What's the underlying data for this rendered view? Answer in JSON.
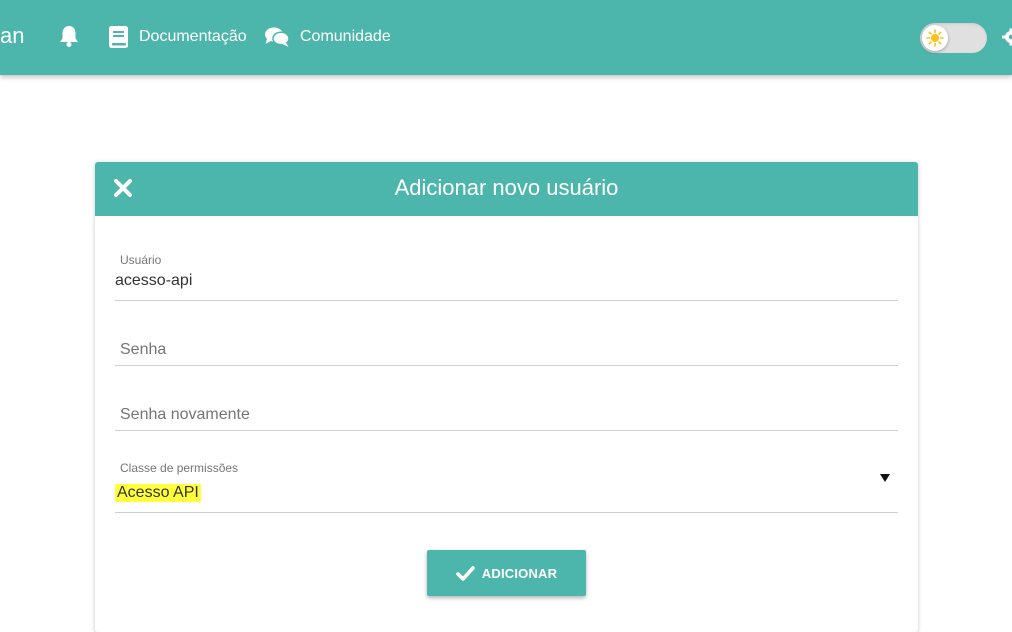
{
  "navbar": {
    "brand_fragment": "an",
    "links": [
      {
        "label": "Documentação",
        "icon": "book-icon"
      },
      {
        "label": "Comunidade",
        "icon": "chat-icon"
      }
    ],
    "theme_toggle": {
      "state": "light",
      "icon": "sun-icon"
    }
  },
  "dialog": {
    "title": "Adicionar novo usuário",
    "fields": {
      "username": {
        "label": "Usuário",
        "value": "acesso-api"
      },
      "password": {
        "placeholder": "Senha"
      },
      "password_confirm": {
        "placeholder": "Senha novamente"
      },
      "permission_class": {
        "label": "Classe de permissões",
        "value": "Acesso API"
      }
    },
    "submit_label": "ADICIONAR"
  },
  "colors": {
    "primary": "#4db6ac",
    "highlight": "#ffff3b",
    "sun": "#f9c21a"
  }
}
